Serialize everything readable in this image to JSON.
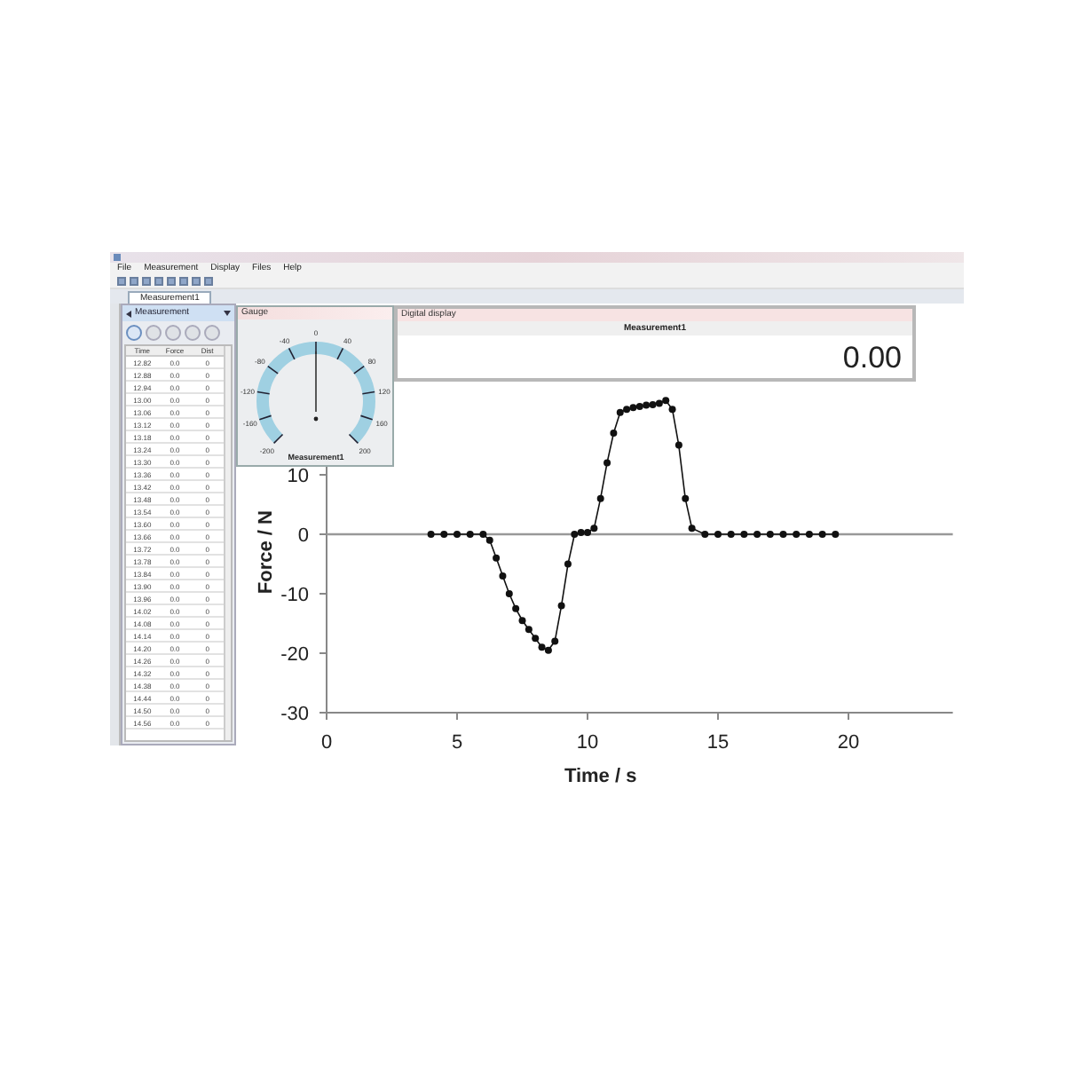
{
  "menu": [
    "File",
    "Measurement",
    "Display",
    "Files",
    "Help"
  ],
  "tabs": [
    {
      "label": "Measurement1",
      "selected": true
    }
  ],
  "left_panel": {
    "selector": "Measurement",
    "columns": [
      "Time",
      "Force",
      "Dist"
    ],
    "rows": [
      [
        "12.82",
        "0.0",
        "0"
      ],
      [
        "12.88",
        "0.0",
        "0"
      ],
      [
        "12.94",
        "0.0",
        "0"
      ],
      [
        "13.00",
        "0.0",
        "0"
      ],
      [
        "13.06",
        "0.0",
        "0"
      ],
      [
        "13.12",
        "0.0",
        "0"
      ],
      [
        "13.18",
        "0.0",
        "0"
      ],
      [
        "13.24",
        "0.0",
        "0"
      ],
      [
        "13.30",
        "0.0",
        "0"
      ],
      [
        "13.36",
        "0.0",
        "0"
      ],
      [
        "13.42",
        "0.0",
        "0"
      ],
      [
        "13.48",
        "0.0",
        "0"
      ],
      [
        "13.54",
        "0.0",
        "0"
      ],
      [
        "13.60",
        "0.0",
        "0"
      ],
      [
        "13.66",
        "0.0",
        "0"
      ],
      [
        "13.72",
        "0.0",
        "0"
      ],
      [
        "13.78",
        "0.0",
        "0"
      ],
      [
        "13.84",
        "0.0",
        "0"
      ],
      [
        "13.90",
        "0.0",
        "0"
      ],
      [
        "13.96",
        "0.0",
        "0"
      ],
      [
        "14.02",
        "0.0",
        "0"
      ],
      [
        "14.08",
        "0.0",
        "0"
      ],
      [
        "14.14",
        "0.0",
        "0"
      ],
      [
        "14.20",
        "0.0",
        "0"
      ],
      [
        "14.26",
        "0.0",
        "0"
      ],
      [
        "14.32",
        "0.0",
        "0"
      ],
      [
        "14.38",
        "0.0",
        "0"
      ],
      [
        "14.44",
        "0.0",
        "0"
      ],
      [
        "14.50",
        "0.0",
        "0"
      ],
      [
        "14.56",
        "0.0",
        "0"
      ]
    ]
  },
  "gauge": {
    "title": "Gauge",
    "scale": [
      "-200",
      "-160",
      "-120",
      "-80",
      "-40",
      "0",
      "40",
      "80",
      "120",
      "160",
      "200"
    ],
    "caption": "Measurement1"
  },
  "digital_display": {
    "title": "Digital display",
    "name": "Measurement1",
    "value": "0.00"
  },
  "chart": {
    "chart_data": {
      "type": "line",
      "xlabel": "Time / s",
      "ylabel": "Force / N",
      "xlim": [
        0,
        24
      ],
      "ylim": [
        -30,
        25
      ],
      "xticks": [
        0,
        5,
        10,
        15,
        20
      ],
      "yticks": [
        -30,
        -20,
        -10,
        0,
        10
      ],
      "x": [
        4,
        4.5,
        5,
        5.5,
        6,
        6.25,
        6.5,
        6.75,
        7,
        7.25,
        7.5,
        7.75,
        8,
        8.25,
        8.5,
        8.75,
        9,
        9.25,
        9.5,
        9.75,
        10,
        10.25,
        10.5,
        10.75,
        11,
        11.25,
        11.5,
        11.75,
        12,
        12.25,
        12.5,
        12.75,
        13,
        13.25,
        13.5,
        13.75,
        14,
        14.5,
        15,
        15.5,
        16,
        16.5,
        17,
        17.5,
        18,
        18.5,
        19,
        19.5
      ],
      "series": [
        {
          "color": "#111111",
          "marker": "circle",
          "values": [
            0,
            0,
            0,
            0,
            0,
            -1,
            -4,
            -7,
            -10,
            -12.5,
            -14.5,
            -16,
            -17.5,
            -19,
            -19.5,
            -18,
            -12,
            -5,
            0,
            0.3,
            0.3,
            1,
            6,
            12,
            17,
            20.5,
            21,
            21.3,
            21.5,
            21.7,
            21.8,
            22,
            22.5,
            21,
            15,
            6,
            1,
            0,
            0,
            0,
            0,
            0,
            0,
            0,
            0,
            0,
            0,
            0
          ]
        }
      ]
    }
  }
}
